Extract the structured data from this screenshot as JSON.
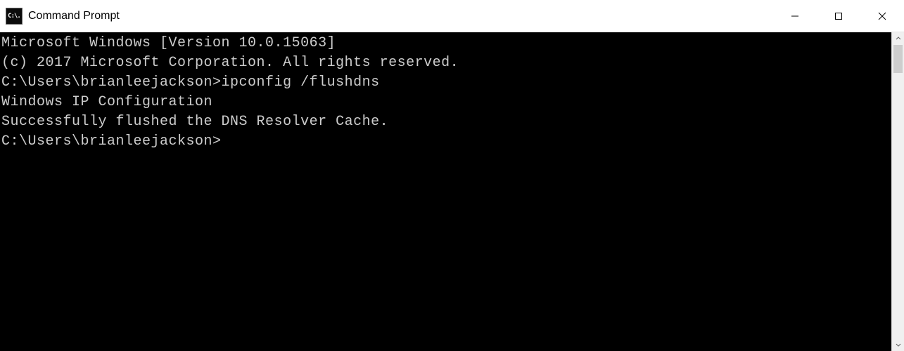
{
  "window": {
    "title": "Command Prompt",
    "icon_label": "C:\\."
  },
  "terminal": {
    "lines": [
      "Microsoft Windows [Version 10.0.15063]",
      "(c) 2017 Microsoft Corporation. All rights reserved.",
      "",
      "C:\\Users\\brianleejackson>ipconfig /flushdns",
      "",
      "Windows IP Configuration",
      "",
      "Successfully flushed the DNS Resolver Cache.",
      "",
      "C:\\Users\\brianleejackson>"
    ]
  }
}
